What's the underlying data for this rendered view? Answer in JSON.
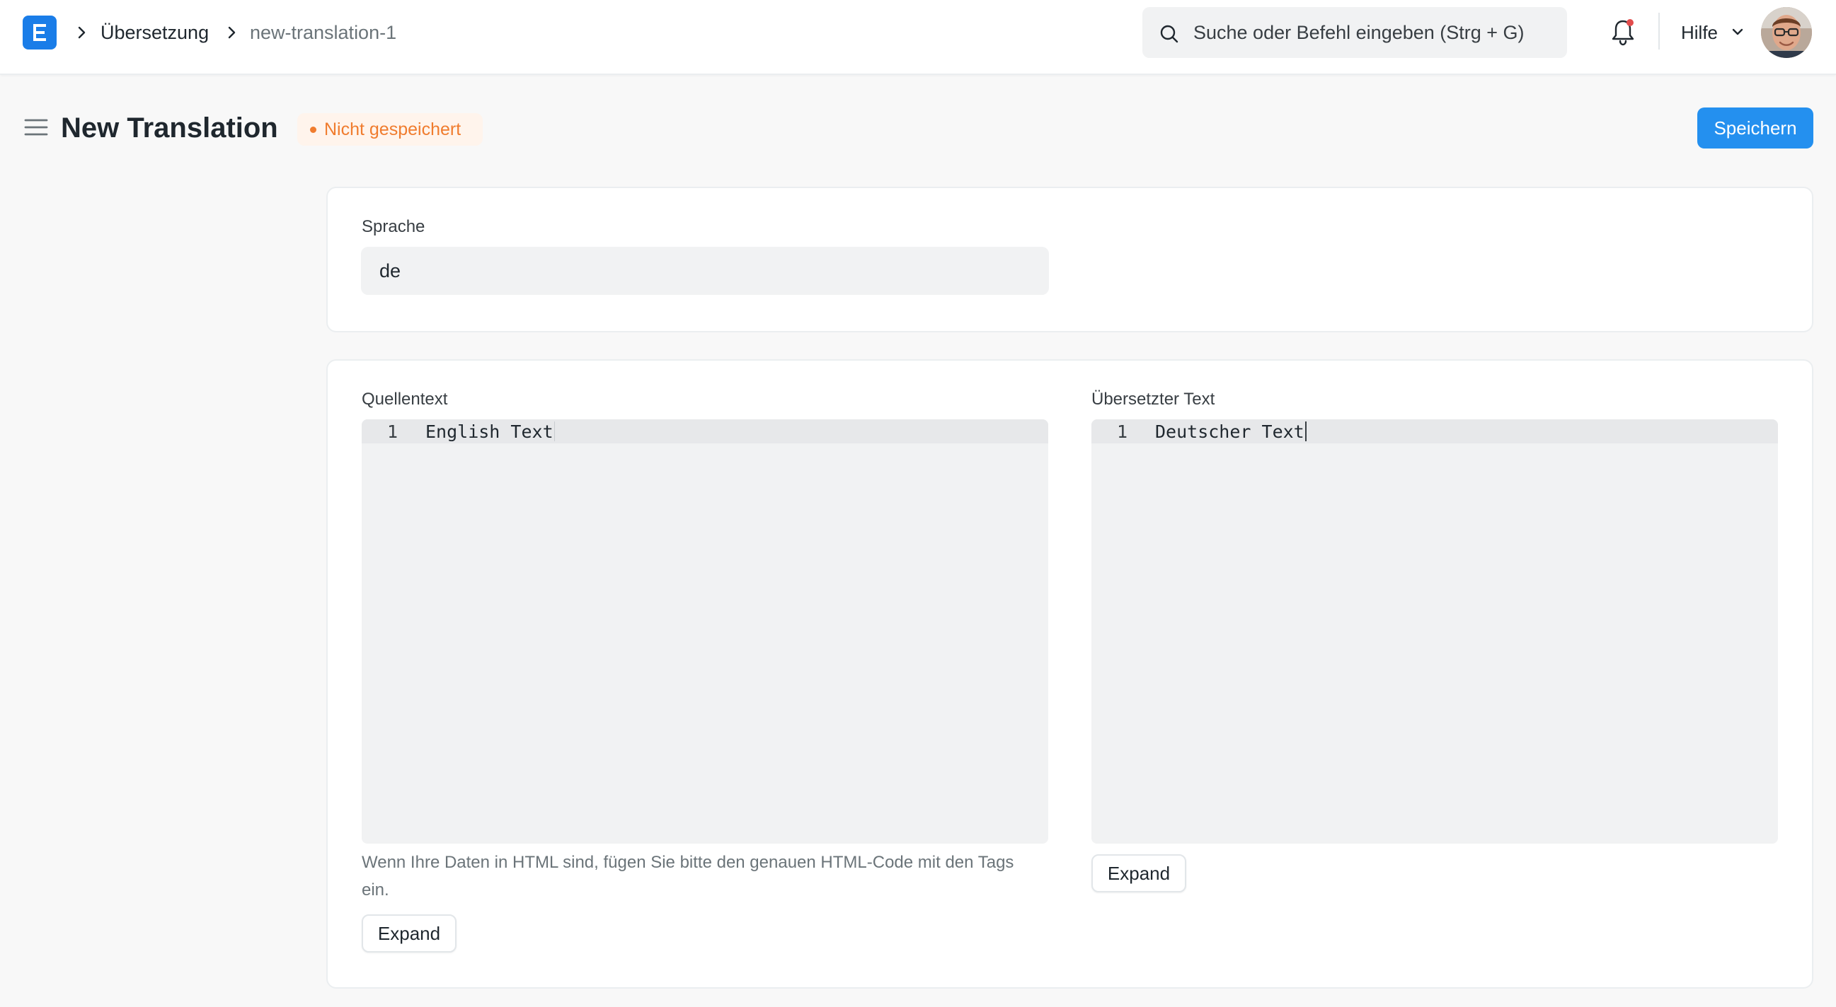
{
  "app": {
    "logo_letter": "E",
    "brand_color": "#1a7de8"
  },
  "breadcrumb": {
    "items": [
      {
        "label": "Übersetzung"
      },
      {
        "label": "new-translation-1"
      }
    ]
  },
  "search": {
    "placeholder": "Suche oder Befehl eingeben (Strg + G)",
    "icon": "search-icon"
  },
  "navbar": {
    "notifications_icon": "bell-icon",
    "help_label": "Hilfe",
    "help_icon": "chevron-down-icon"
  },
  "page": {
    "title": "New Translation",
    "status": "Nicht gespeichert",
    "status_color": "#f07c2e",
    "save_label": "Speichern",
    "save_color": "#2490ef"
  },
  "form": {
    "language": {
      "label": "Sprache",
      "value": "de"
    },
    "source": {
      "label": "Quellentext",
      "line_number": "1",
      "content": "English Text",
      "help": "Wenn Ihre Daten in HTML sind, fügen Sie bitte den genauen HTML-Code mit den Tags ein.",
      "expand_label": "Expand"
    },
    "translated": {
      "label": "Übersetzter Text",
      "line_number": "1",
      "content": "Deutscher Text",
      "expand_label": "Expand"
    }
  }
}
